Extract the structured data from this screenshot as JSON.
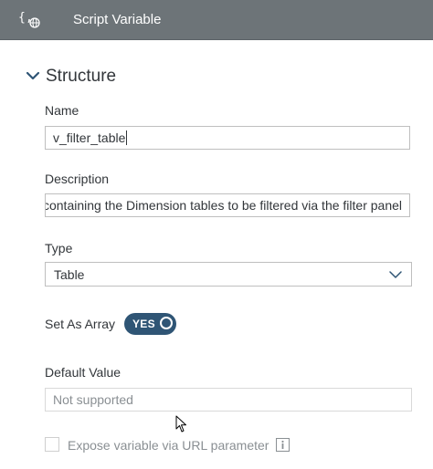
{
  "header": {
    "icon": "script-variable-globe-icon",
    "title": "Script Variable"
  },
  "section": {
    "title": "Structure",
    "expanded": true
  },
  "fields": {
    "name": {
      "label": "Name",
      "value": "v_filter_table"
    },
    "description": {
      "label": "Description",
      "value": "Table containing the Dimension tables to be filtered via the filter panel"
    },
    "type": {
      "label": "Type",
      "selected": "Table"
    },
    "set_as_array": {
      "label": "Set As Array",
      "toggle_text": "YES",
      "on": true
    },
    "default_value": {
      "label": "Default Value",
      "placeholder": "Not supported"
    },
    "expose": {
      "label": "Expose variable via URL parameter",
      "checked": false,
      "disabled": true
    }
  },
  "colors": {
    "header_bg": "#6d7478",
    "toggle_bg": "#2f5575",
    "text": "#32363a",
    "disabled_text": "#8a8f93",
    "accent": "#2f5575"
  }
}
